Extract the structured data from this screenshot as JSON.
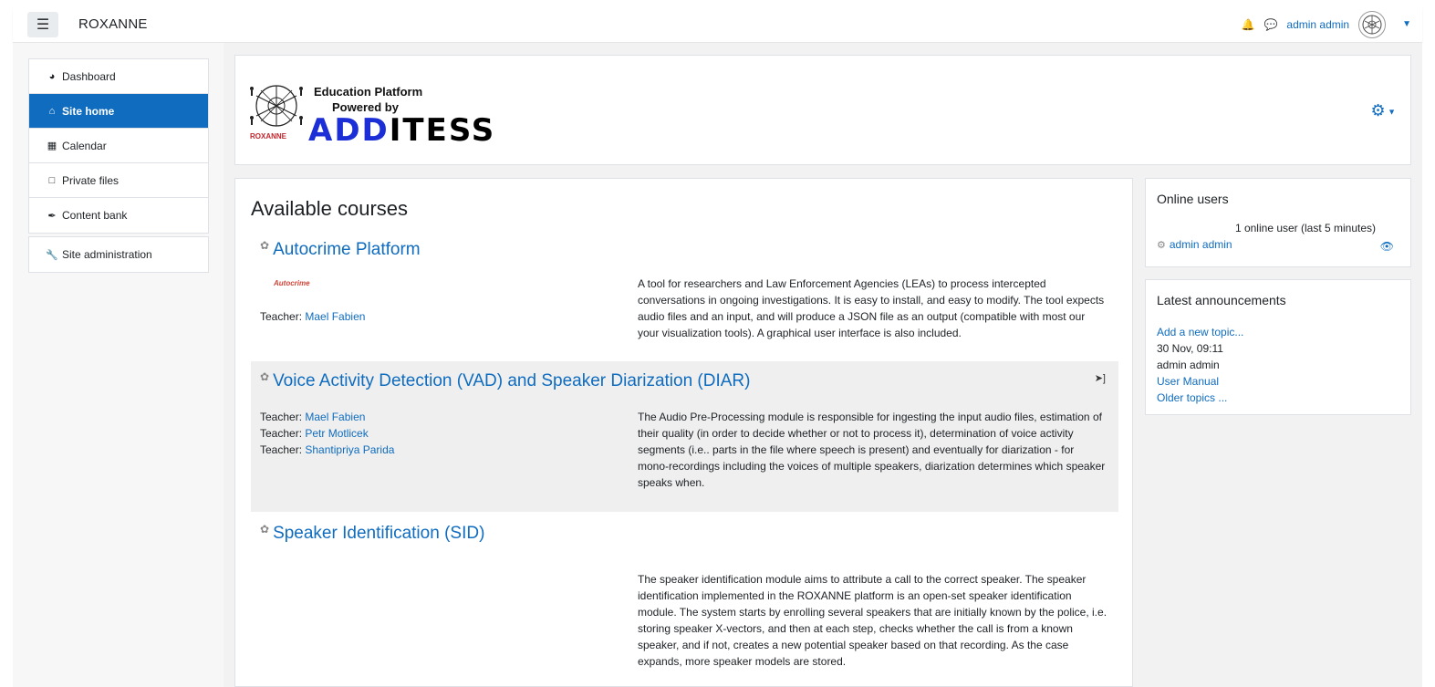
{
  "navbar": {
    "brand": "ROXANNE",
    "user_name": "admin admin",
    "icons": [
      "menu-icon",
      "bell-icon",
      "chat-icon",
      "avatar",
      "chevron-down-icon"
    ]
  },
  "sidebar": {
    "items": [
      {
        "label": "Dashboard",
        "icon": "dashboard-icon"
      },
      {
        "label": "Site home",
        "icon": "home-icon",
        "active": true
      },
      {
        "label": "Calendar",
        "icon": "calendar-icon"
      },
      {
        "label": "Private files",
        "icon": "file-icon"
      },
      {
        "label": "Content bank",
        "icon": "brush-icon"
      }
    ],
    "admin_item": {
      "label": "Site administration",
      "icon": "wrench-icon"
    }
  },
  "header": {
    "logo_line1": "Education Platform",
    "logo_line2": "Powered by",
    "logo_word_a": "ADD",
    "logo_word_b": "ITESS",
    "logo_roxanne": "ROXANNE"
  },
  "main": {
    "title": "Available courses",
    "courses": [
      {
        "name": "Autocrime Platform",
        "image_text": "Autocrime",
        "teachers": [
          {
            "role": "Teacher:",
            "name": "Mael Fabien"
          }
        ],
        "summary": "A tool for researchers and Law Enforcement Agencies (LEAs) to process intercepted conversations in ongoing investigations. It is easy to install, and easy to modify. The tool expects audio files and an input, and will produce a JSON file as an output (compatible with most our your visualization tools). A graphical user interface is also included."
      },
      {
        "name": "Voice Activity Detection (VAD) and Speaker Diarization (DIAR)",
        "teachers": [
          {
            "role": "Teacher:",
            "name": "Mael Fabien"
          },
          {
            "role": "Teacher:",
            "name": "Petr Motlicek"
          },
          {
            "role": "Teacher:",
            "name": "Shantipriya Parida"
          }
        ],
        "summary": "The Audio Pre-Processing module is responsible for ingesting the input audio files, estimation of their quality (in order to decide whether or not to process it), determination of voice activity segments (i.e.. parts in the file where speech is present) and eventually for diarization - for mono-recordings including the voices of multiple speakers, diarization determines which speaker speaks when."
      },
      {
        "name": "Speaker Identification (SID)",
        "teachers": [],
        "summary": "The speaker identification module aims to attribute a call to the correct speaker. The speaker identification implemented in the ROXANNE platform is an open-set speaker identification module. The system starts by enrolling several speakers that are initially known by the police, i.e. storing speaker X-vectors, and then at each step, checks whether the call is from a known speaker, and if not, creates a new potential speaker based on that recording. As the case expands, more speaker models are stored."
      }
    ]
  },
  "online_users": {
    "title": "Online users",
    "summary": "1 online user (last 5 minutes)",
    "users": [
      "admin admin"
    ]
  },
  "announcements": {
    "title": "Latest announcements",
    "add_topic": "Add a new topic...",
    "date": "30 Nov, 09:11",
    "author": "admin admin",
    "post_title": "User Manual",
    "older": "Older topics ..."
  }
}
